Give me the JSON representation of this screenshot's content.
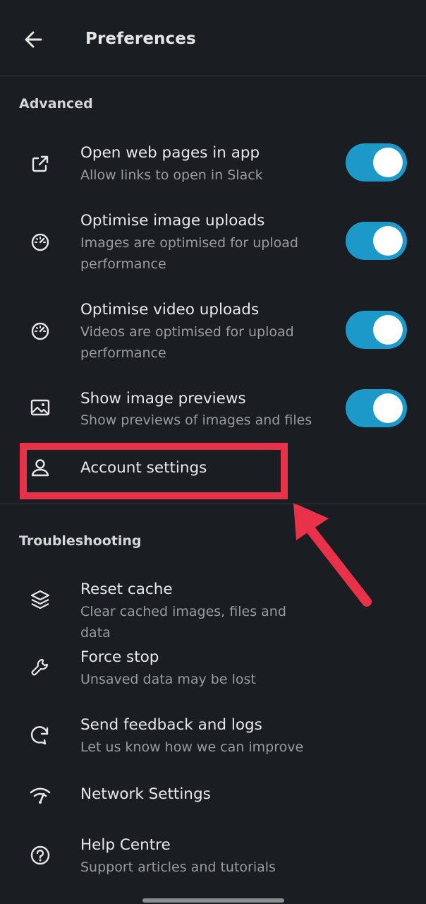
{
  "header": {
    "title": "Preferences",
    "back_icon": "arrow-left-icon"
  },
  "sections": {
    "advanced": {
      "label": "Advanced"
    },
    "troubleshooting": {
      "label": "Troubleshooting"
    }
  },
  "advanced_items": [
    {
      "icon": "external-link-icon",
      "title": "Open web pages in app",
      "subtitle": "Allow links to open in Slack",
      "toggle_on": true
    },
    {
      "icon": "speedometer-icon",
      "title": "Optimise image uploads",
      "subtitle": "Images are optimised for upload performance",
      "toggle_on": true
    },
    {
      "icon": "speedometer-icon",
      "title": "Optimise video uploads",
      "subtitle": "Videos are optimised for upload performance",
      "toggle_on": true
    },
    {
      "icon": "image-icon",
      "title": "Show image previews",
      "subtitle": "Show previews of images and files",
      "toggle_on": true
    },
    {
      "icon": "person-icon",
      "title": "Account settings"
    }
  ],
  "troubleshooting_items": [
    {
      "icon": "layers-icon",
      "title": "Reset cache",
      "subtitle": "Clear cached images, files and data"
    },
    {
      "icon": "wrench-icon",
      "title": "Force stop",
      "subtitle": "Unsaved data may be lost"
    },
    {
      "icon": "refresh-chat-icon",
      "title": "Send feedback and logs",
      "subtitle": "Let us know how we can improve"
    },
    {
      "icon": "wifi-icon",
      "title": "Network Settings"
    },
    {
      "icon": "help-circle-icon",
      "title": "Help Centre",
      "subtitle": "Support articles and tutorials"
    }
  ],
  "colors": {
    "background": "#1a1d21",
    "toggle_on": "#1c98c9",
    "highlight": "#e8324a"
  }
}
